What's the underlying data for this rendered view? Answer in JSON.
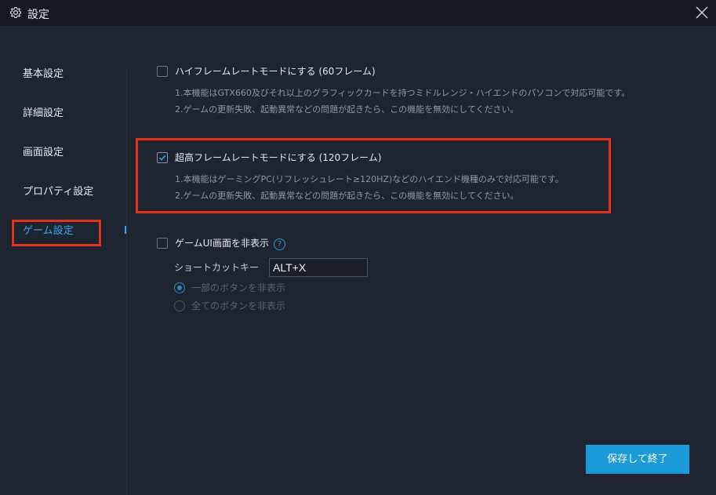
{
  "window": {
    "title": "設定",
    "icons": {
      "title": "gear-icon",
      "close": "close-icon"
    }
  },
  "sidebar": {
    "items": [
      {
        "label": "基本設定",
        "active": false
      },
      {
        "label": "詳細設定",
        "active": false
      },
      {
        "label": "画面設定",
        "active": false
      },
      {
        "label": "プロパティ設定",
        "active": false
      },
      {
        "label": "ゲーム設定",
        "active": true
      }
    ]
  },
  "game_settings": {
    "high_frame": {
      "label": "ハイフレームレートモードにする (60フレーム)",
      "checked": false,
      "desc1": "1.本機能はGTX660及びそれ以上のグラフィックカードを持つミドルレンジ・ハイエンドのパソコンで対応可能です。",
      "desc2": "2.ゲームの更新失敗、起動異常などの問題が起きたら、この機能を無効にしてください。"
    },
    "ultra_frame": {
      "label": "超高フレームレートモードにする (120フレーム)",
      "checked": true,
      "desc1": "1.本機能はゲーミングPC(リフレッシュレート≥120HZ)などのハイエンド機種のみで対応可能です。",
      "desc2": "2.ゲームの更新失敗、起動異常などの問題が起きたら、この機能を無効にしてください。"
    },
    "hide_ui": {
      "label": "ゲームUI画面を非表示",
      "checked": false,
      "help_icon_glyph": "?",
      "shortcut_label": "ショートカットキー",
      "shortcut_value": "ALT+X",
      "options": [
        {
          "label": "一部のボタンを非表示",
          "selected": true
        },
        {
          "label": "全てのボタンを非表示",
          "selected": false
        }
      ]
    }
  },
  "footer": {
    "save_label": "保存して終了"
  },
  "colors": {
    "background": "#1e2430",
    "titlebar": "#151a22",
    "accent": "#35a7ea",
    "button": "#1b9ad9",
    "highlight_border": "#e0321e"
  }
}
